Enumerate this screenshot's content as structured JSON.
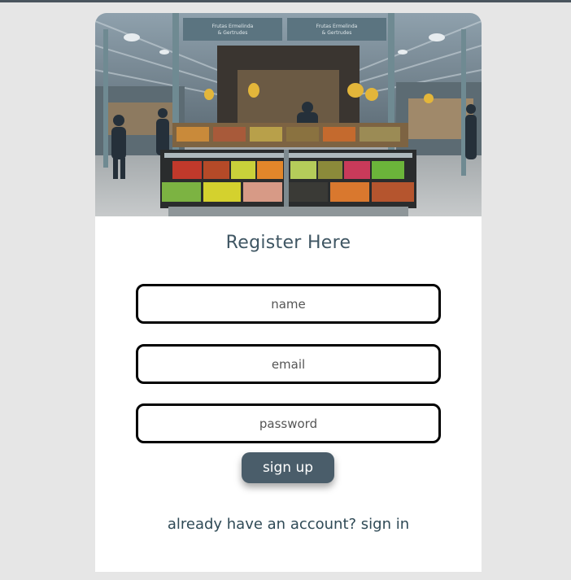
{
  "hero": {
    "alt": "market stall with fruits and vegetables",
    "signs": [
      "Frutas Ermelinda",
      "& Gertrudes"
    ]
  },
  "form": {
    "title": "Register Here",
    "name_placeholder": "name",
    "email_placeholder": "email",
    "password_placeholder": "password",
    "submit_label": "sign up",
    "signin_text": "already have an account? sign in"
  },
  "colors": {
    "page_bg": "#e6e6e6",
    "card_bg": "#ffffff",
    "title": "#3f5663",
    "button_bg": "#4a5d6a",
    "button_text": "#ffffff",
    "field_border": "#000000"
  }
}
